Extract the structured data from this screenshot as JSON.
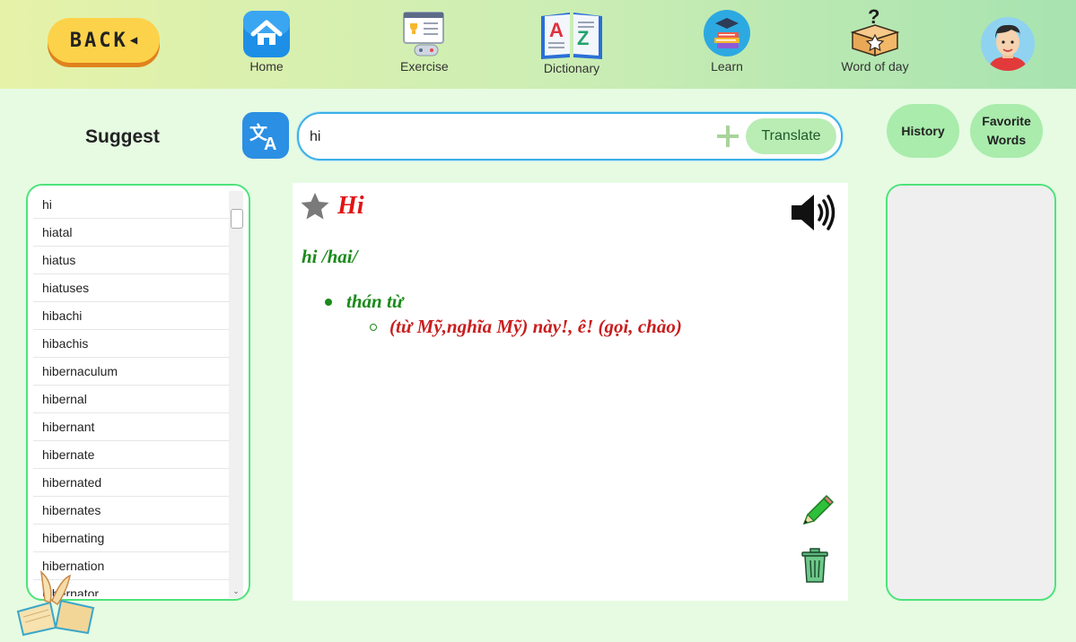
{
  "nav": {
    "back_label": "BACK",
    "items": [
      {
        "label": "Home",
        "icon": "home-icon"
      },
      {
        "label": "Exercise",
        "icon": "exercise-icon"
      },
      {
        "label": "Dictionary",
        "icon": "dictionary-icon"
      },
      {
        "label": "Learn",
        "icon": "learn-icon"
      },
      {
        "label": "Word of day",
        "icon": "word-of-day-icon"
      }
    ],
    "avatar": "avatar-icon"
  },
  "suggest": {
    "title": "Suggest",
    "items": [
      "hi",
      "hiatal",
      "hiatus",
      "hiatuses",
      "hibachi",
      "hibachis",
      "hibernaculum",
      "hibernal",
      "hibernant",
      "hibernate",
      "hibernated",
      "hibernates",
      "hibernating",
      "hibernation",
      "hibernator"
    ]
  },
  "search": {
    "value": "hi",
    "translate_label": "Translate"
  },
  "buttons": {
    "history_label": "History",
    "favorite_line1": "Favorite",
    "favorite_line2": "Words"
  },
  "definition": {
    "word": "Hi",
    "pronunciation": "hi /hai/",
    "part_of_speech": "thán từ",
    "meaning": "(từ Mỹ,nghĩa Mỹ) này!, ê! (gọi, chào)"
  },
  "colors": {
    "accent_green": "#4ee37b",
    "word_red": "#e11414",
    "def_green": "#1a8a1a",
    "search_border": "#3bb0e6"
  }
}
